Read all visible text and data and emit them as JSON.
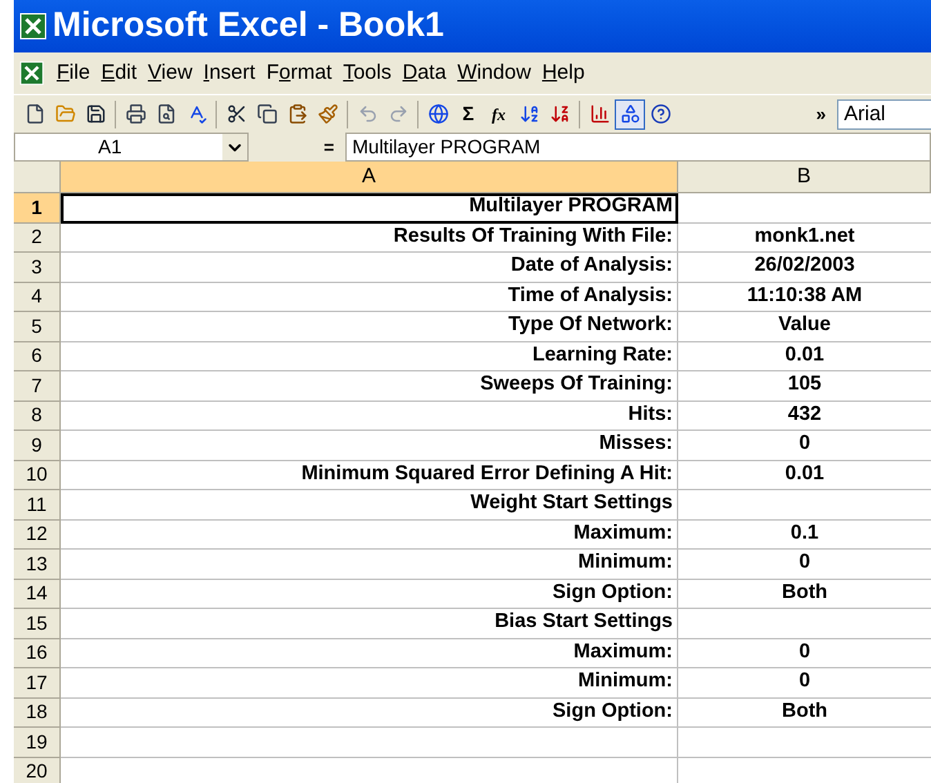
{
  "window": {
    "title": "Microsoft Excel - Book1"
  },
  "menu": [
    {
      "key": "F",
      "post": "ile"
    },
    {
      "key": "E",
      "post": "dit"
    },
    {
      "key": "V",
      "post": "iew"
    },
    {
      "key": "I",
      "post": "nsert"
    },
    {
      "pre": "F",
      "key": "o",
      "post": "rmat"
    },
    {
      "key": "T",
      "post": "ools"
    },
    {
      "key": "D",
      "post": "ata"
    },
    {
      "key": "W",
      "post": "indow"
    },
    {
      "key": "H",
      "post": "elp"
    }
  ],
  "toolbar": {
    "buttons": [
      {
        "disabled": false,
        "pressed": false
      },
      {
        "disabled": false,
        "pressed": false
      },
      {
        "disabled": false,
        "pressed": false
      },
      {
        "disabled": false,
        "pressed": false
      },
      {
        "disabled": false,
        "pressed": false
      },
      {
        "disabled": false,
        "pressed": false
      },
      {
        "disabled": false,
        "pressed": false
      },
      {
        "disabled": false,
        "pressed": false
      },
      {
        "disabled": false,
        "pressed": false
      },
      {
        "disabled": false,
        "pressed": false
      },
      {
        "disabled": true,
        "pressed": false
      },
      {
        "disabled": true,
        "pressed": false
      },
      {
        "disabled": false,
        "pressed": false
      },
      {
        "disabled": false,
        "pressed": false
      },
      {
        "disabled": false,
        "pressed": false
      },
      {
        "disabled": false,
        "pressed": false
      },
      {
        "disabled": false,
        "pressed": false
      },
      {
        "disabled": false,
        "pressed": false
      },
      {
        "disabled": false,
        "pressed": true
      },
      {
        "disabled": false,
        "pressed": false
      }
    ],
    "sum_glyph": "Σ",
    "function_glyph": "fx",
    "overflow": "»",
    "font": "Arial"
  },
  "formula_bar": {
    "name_box": "A1",
    "equals": "=",
    "formula": "Multilayer PROGRAM"
  },
  "columns": [
    {
      "label": "A",
      "selected": true
    },
    {
      "label": "B",
      "selected": false
    }
  ],
  "rows": [
    {
      "num": "1",
      "selected": true,
      "a": "Multilayer PROGRAM"
    },
    {
      "num": "2",
      "selected": false,
      "a": "Results Of Training With File:",
      "b": "monk1.net"
    },
    {
      "num": "3",
      "selected": false,
      "a": "Date of Analysis:",
      "b": "26/02/2003"
    },
    {
      "num": "4",
      "selected": false,
      "a": "Time of Analysis:",
      "b": "11:10:38 AM"
    },
    {
      "num": "5",
      "selected": false,
      "a": "Type Of Network:",
      "b": "Value"
    },
    {
      "num": "6",
      "selected": false,
      "a": "Learning Rate:",
      "b": "0.01"
    },
    {
      "num": "7",
      "selected": false,
      "a": "Sweeps Of Training:",
      "b": "105"
    },
    {
      "num": "8",
      "selected": false,
      "a": "Hits:",
      "b": "432"
    },
    {
      "num": "9",
      "selected": false,
      "a": "Misses:",
      "b": "0"
    },
    {
      "num": "10",
      "selected": false,
      "a": "Minimum Squared Error Defining A Hit:",
      "b": "0.01"
    },
    {
      "num": "11",
      "selected": false,
      "a": "Weight Start Settings"
    },
    {
      "num": "12",
      "selected": false,
      "a": "Maximum:",
      "b": "0.1"
    },
    {
      "num": "13",
      "selected": false,
      "a": "Minimum:",
      "b": "0"
    },
    {
      "num": "14",
      "selected": false,
      "a": "Sign Option:",
      "b": "Both"
    },
    {
      "num": "15",
      "selected": false,
      "a": "Bias Start Settings"
    },
    {
      "num": "16",
      "selected": false,
      "a": "Maximum:",
      "b": "0"
    },
    {
      "num": "17",
      "selected": false,
      "a": "Minimum:",
      "b": "0"
    },
    {
      "num": "18",
      "selected": false,
      "a": "Sign Option:",
      "b": "Both"
    },
    {
      "num": "19",
      "selected": false
    },
    {
      "num": "20",
      "selected": false
    }
  ]
}
